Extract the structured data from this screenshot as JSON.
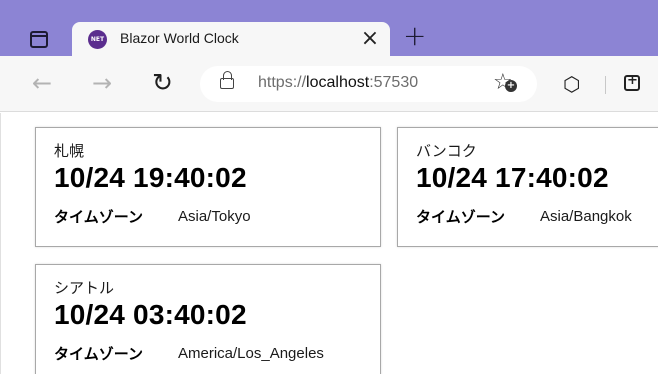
{
  "browser": {
    "tab": {
      "favicon_text": "NET",
      "title": "Blazor World Clock",
      "close": "×"
    },
    "new_tab": "+",
    "address": {
      "url_scheme": "https://",
      "url_host": "localhost",
      "url_port": ":57530"
    },
    "icons": {
      "back": "arrow-left-icon",
      "forward": "arrow-right-icon",
      "reload": "reload-icon",
      "lock": "lock-icon",
      "favorite": "add-favorite-icon",
      "extensions": "puzzle-icon",
      "collections": "collections-icon"
    },
    "colors": {
      "tabstrip": "#8c84d4",
      "toolbar": "#f7f7f7",
      "favicon": "#5b2d8e"
    }
  },
  "clocks": [
    {
      "city": "札幌",
      "time": "10/24 19:40:02",
      "tz_label": "タイムゾーン",
      "tz": "Asia/Tokyo"
    },
    {
      "city": "バンコク",
      "time": "10/24 17:40:02",
      "tz_label": "タイムゾーン",
      "tz": "Asia/Bangkok"
    },
    {
      "city": "シアトル",
      "time": "10/24 03:40:02",
      "tz_label": "タイムゾーン",
      "tz": "America/Los_Angeles"
    }
  ]
}
